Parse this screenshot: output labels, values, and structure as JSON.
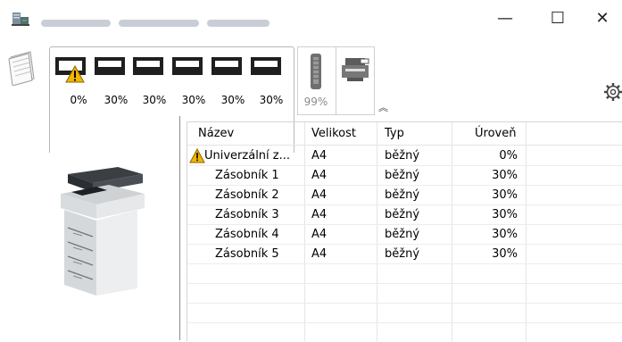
{
  "window": {
    "minimize_label": "—",
    "maximize_label": "☐",
    "close_label": "✕"
  },
  "toolbar": {
    "tray_levels": [
      "0%",
      "30%",
      "30%",
      "30%",
      "30%",
      "30%"
    ],
    "toner_level": "99%",
    "collapse_label": "︽",
    "icons": {
      "app": "printer-status-icon",
      "paper": "paper-stack-icon",
      "toner": "toner-cartridge-icon",
      "printer": "printer-device-icon",
      "settings": "gear-icon",
      "warning": "warning-icon"
    },
    "colors": {
      "warning": "#f2b500",
      "tray": "#1f1f1f"
    }
  },
  "table": {
    "headers": [
      "Název",
      "Velikost",
      "Typ",
      "Úroveň"
    ],
    "rows": [
      {
        "name": "Univerzální z...",
        "size": "A4",
        "type": "běžný",
        "level": "0%",
        "warning": true
      },
      {
        "name": "Zásobník 1",
        "size": "A4",
        "type": "běžný",
        "level": "30%",
        "warning": false
      },
      {
        "name": "Zásobník 2",
        "size": "A4",
        "type": "běžný",
        "level": "30%",
        "warning": false
      },
      {
        "name": "Zásobník 3",
        "size": "A4",
        "type": "běžný",
        "level": "30%",
        "warning": false
      },
      {
        "name": "Zásobník 4",
        "size": "A4",
        "type": "běžný",
        "level": "30%",
        "warning": false
      },
      {
        "name": "Zásobník 5",
        "size": "A4",
        "type": "běžný",
        "level": "30%",
        "warning": false
      }
    ]
  }
}
